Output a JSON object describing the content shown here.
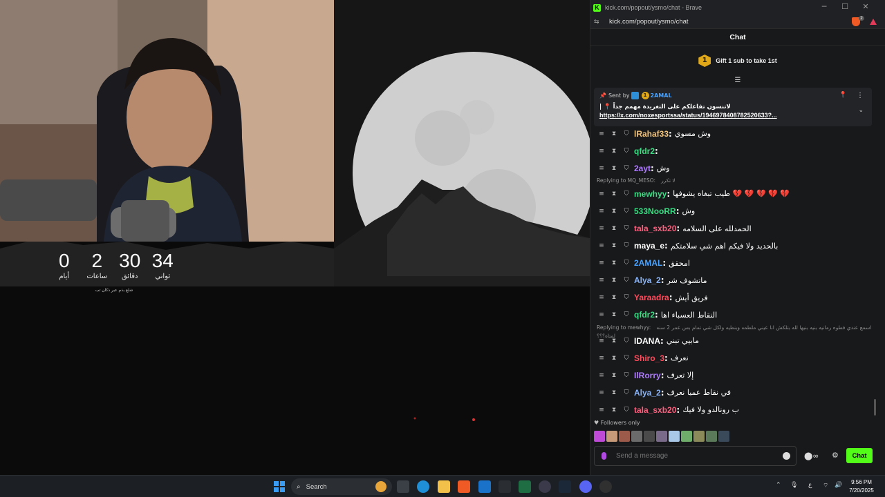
{
  "countdown": {
    "days": "0",
    "days_label": "أيام",
    "hours": "2",
    "hours_label": "ساعات",
    "minutes": "30",
    "minutes_label": "دقائق",
    "seconds": "34",
    "seconds_label": "ثواني",
    "note": "شلع بذم عبر ذكان تب"
  },
  "browser": {
    "title": "kick.com/popout/ysmo/chat - Brave",
    "url": "kick.com/popout/ysmo/chat",
    "logo": "K",
    "shield_badge": "2"
  },
  "chat": {
    "header": "Chat",
    "gift_badge": "1",
    "gift_text": "Gift 1 sub to take 1st",
    "pinned": {
      "sent_by": "Sent by",
      "badge": "1",
      "user": "2AMAL",
      "message": "لاتنسون تفاعلكم على التغريدة مهمم جداً 📍 |",
      "link": "https://x.com/noxesportssa/status/1946978408782520633?..."
    },
    "messages": [
      {
        "user": "lRahaf33",
        "color": "#f0c27a",
        "text": "وش مسوي"
      },
      {
        "user": "qfdr2",
        "color": "#3ddc84",
        "text": ""
      },
      {
        "user": "2ayt",
        "color": "#b07cff",
        "text": "وش"
      },
      {
        "reply_to": "Replying to MQ_MESO:",
        "reply_text": "لا تكرر",
        "user": "mewhyy",
        "color": "#3ddc84",
        "text": "طيب تبغاه يشوفها 💔 💔 💔 💔 💔"
      },
      {
        "user": "533NooRR",
        "color": "#3ddc84",
        "text": "وش"
      },
      {
        "user": "tala_sxb20",
        "color": "#ff5f7e",
        "text": "الحمدلله على السلامه"
      },
      {
        "user": "maya_e",
        "color": "#ffffff",
        "text": "بالحديد ولا فيكم اهم شي سلامتكم"
      },
      {
        "user": "2AMAL",
        "color": "#4aa3ff",
        "text": "امحقق"
      },
      {
        "user": "Alya_2",
        "color": "#8ab4f8",
        "text": "ماتشوف شر"
      },
      {
        "user": "Yaraadra",
        "color": "#ff4b5c",
        "text": "فريق أيش"
      },
      {
        "user": "qfdr2",
        "color": "#3ddc84",
        "text": "النقاط العسباء اها"
      },
      {
        "reply_to": "Replying to mewhyy:",
        "reply_text": "اسمع عندي فطوه رمانيه بنيه بنيها لله بتلكش انا عيني ملطمه وبنطيه ولكل شي تمام بس عمر 2 سنه لمتاه؟؟؟",
        "user": "IDANA",
        "color": "#ffffff",
        "text": "مابيي تبني"
      },
      {
        "user": "Shiro_3",
        "color": "#ff4b5c",
        "text": "نعرف"
      },
      {
        "user": "IlRorry",
        "color": "#b07cff",
        "text": "إلا تعرف"
      },
      {
        "user": "Alya_2",
        "color": "#8ab4f8",
        "text": "في نقاط عميا نعرف"
      },
      {
        "user": "tala_sxb20",
        "color": "#ff5f7e",
        "text": "ب رونالدو ولا فيك"
      }
    ],
    "followers_only": "Followers only",
    "input_placeholder": "Send a message",
    "send_label": "Chat"
  },
  "taskbar": {
    "search_label": "Search",
    "time": "9:56 PM",
    "date": "7/20/2025",
    "lang": "ع"
  },
  "colors": {
    "kick_green": "#53fc18",
    "panel_bg": "#18191b",
    "taskbar_bg": "#1c1f24"
  }
}
